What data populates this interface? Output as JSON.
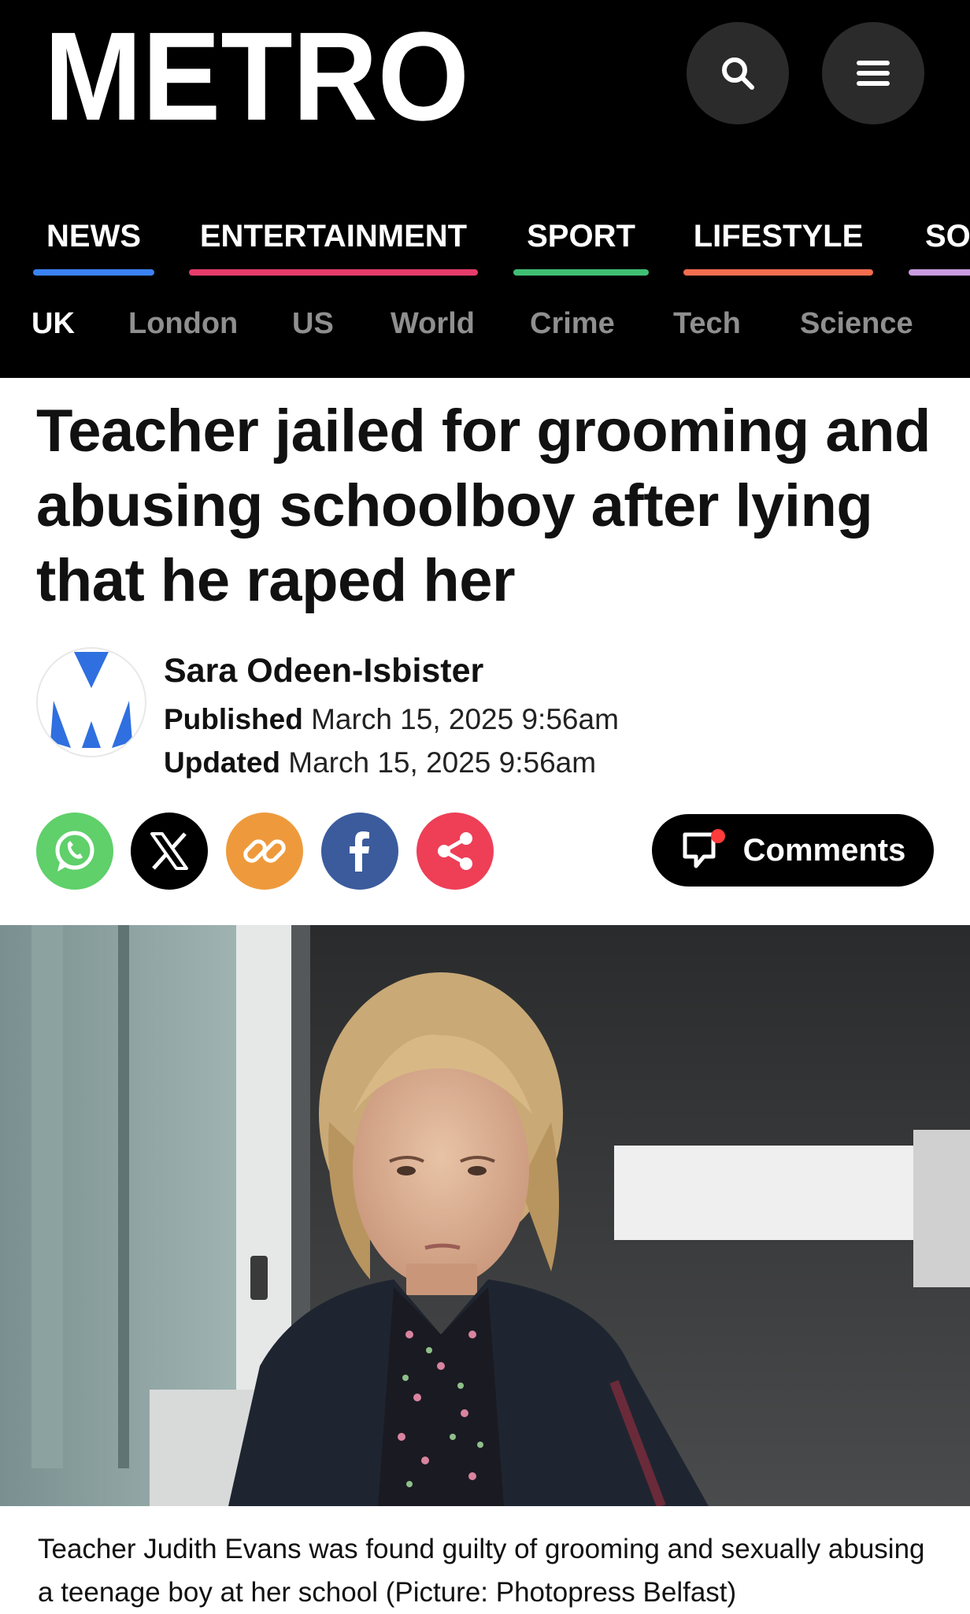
{
  "site": {
    "logo_text": "METRO"
  },
  "header": {
    "search_icon": "search-icon",
    "menu_icon": "hamburger-menu-icon"
  },
  "sections": [
    {
      "label": "NEWS",
      "color": "#3b82f6"
    },
    {
      "label": "ENTERTAINMENT",
      "color": "#e63d6b"
    },
    {
      "label": "SPORT",
      "color": "#3fbf73"
    },
    {
      "label": "LIFESTYLE",
      "color": "#f26d4f"
    },
    {
      "label": "SOA",
      "color": "#c99be0"
    }
  ],
  "subnav": [
    "UK",
    "London",
    "US",
    "World",
    "Crime",
    "Tech",
    "Science"
  ],
  "article": {
    "headline": "Teacher jailed for grooming and abusing schoolboy after lying that he raped her",
    "author": "Sara Odeen-Isbister",
    "published_label": "Published",
    "published_date": "March 15, 2025 9:56am",
    "updated_label": "Updated",
    "updated_date": "March 15, 2025 9:56am",
    "caption": "Teacher Judith Evans was found guilty of grooming and sexually abusing a teenage boy at her school (Picture: Photopress Belfast)"
  },
  "share": [
    {
      "icon": "whatsapp-icon",
      "color": "#5fd06a"
    },
    {
      "icon": "x-icon",
      "color": "#000000"
    },
    {
      "icon": "link-icon",
      "color": "#ee9a3c"
    },
    {
      "icon": "facebook-icon",
      "color": "#3b5b9d"
    },
    {
      "icon": "share-icon",
      "color": "#ee3f57"
    }
  ],
  "comments": {
    "label": "Comments",
    "icon": "comment-bubble-icon",
    "dot_color": "#ff3b3b"
  }
}
